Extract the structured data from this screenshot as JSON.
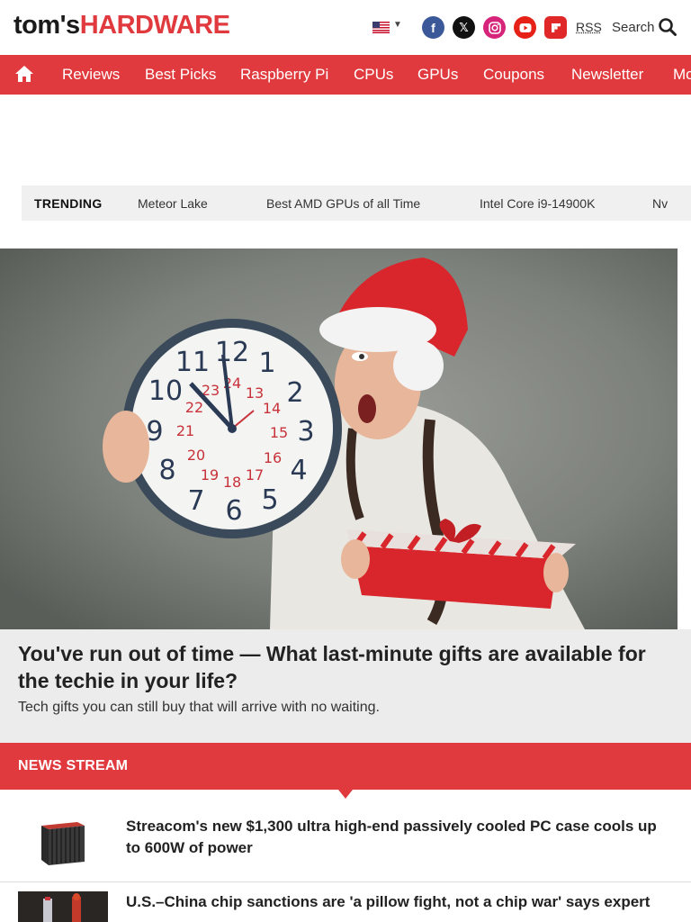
{
  "header": {
    "logo_part1": "tom's",
    "logo_part2": "HARDWARE",
    "flag_icon": "us-flag-icon",
    "social": [
      {
        "name": "facebook",
        "glyph": "f",
        "color": "#3b5998"
      },
      {
        "name": "x-twitter",
        "glyph": "𝕏",
        "color": "#111111"
      },
      {
        "name": "instagram",
        "glyph": "◎",
        "color": "#d6247a"
      },
      {
        "name": "youtube",
        "glyph": "▶",
        "color": "#e62117"
      },
      {
        "name": "flipboard",
        "glyph": "f",
        "color": "#e12828"
      }
    ],
    "rss_label": "RSS",
    "search_label": "Search"
  },
  "nav": {
    "home_icon": "home-icon",
    "items": [
      "Reviews",
      "Best Picks",
      "Raspberry Pi",
      "CPUs",
      "GPUs",
      "Coupons",
      "Newsletter",
      "Mo"
    ]
  },
  "trending": {
    "label": "TRENDING",
    "items": [
      "Meteor Lake",
      "Best AMD GPUs of all Time",
      "Intel Core i9-14900K",
      "Nv"
    ]
  },
  "hero": {
    "title": "You've run out of time — What last-minute gifts are available for the techie in your life?",
    "subtitle": "Tech gifts you can still buy that will arrive with no waiting."
  },
  "news_stream": {
    "label": "NEWS STREAM",
    "items": [
      {
        "title": "Streacom's new $1,300 ultra high-end passively cooled PC case cools up to 600W of power"
      },
      {
        "title": "U.S.–China chip sanctions are 'a pillow fight, not a chip war' says expert"
      }
    ]
  },
  "colors": {
    "brand_red": "#e03a3e",
    "caption_bg": "#ececec",
    "trending_bg": "#f0f0f0"
  }
}
